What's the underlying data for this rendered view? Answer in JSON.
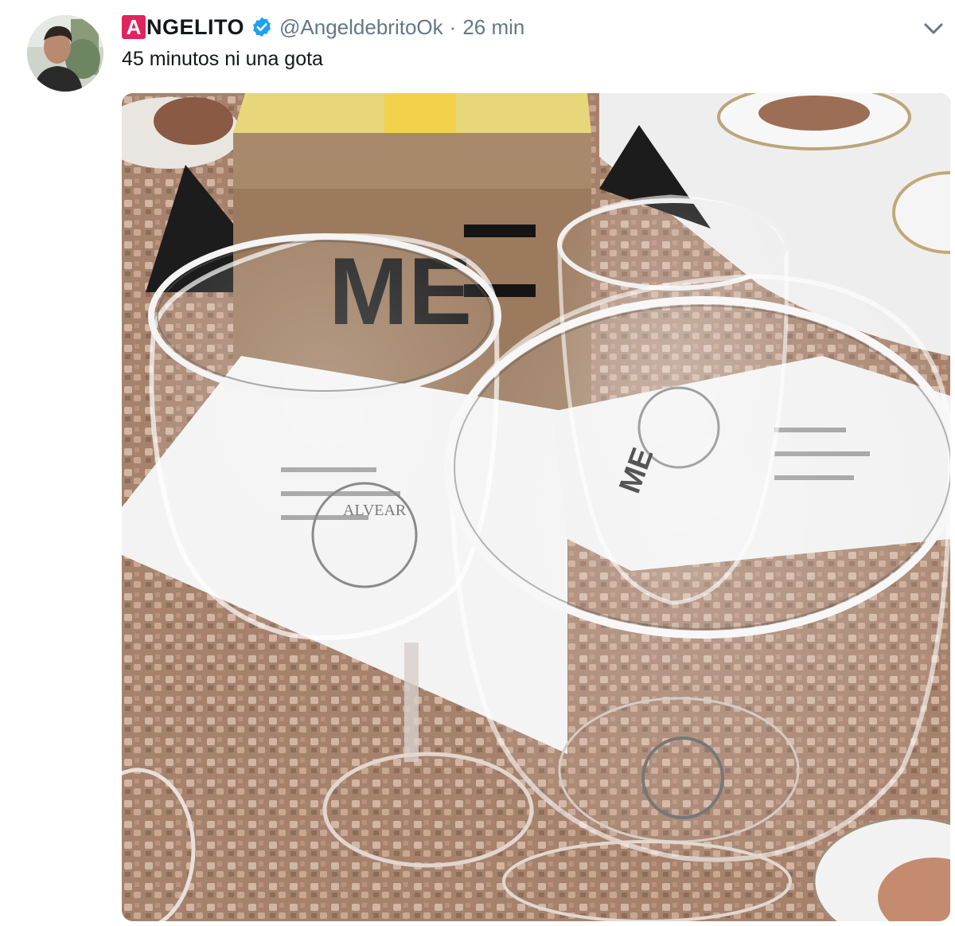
{
  "tweet": {
    "brand_letter": "A",
    "display_name": "NGELITO",
    "handle": "@AngeldebritoOk",
    "separator": "·",
    "time": "26 min",
    "text": "45 minutos ni una gota",
    "verified_icon": "verified-badge-icon",
    "menu_icon": "chevron-down-icon",
    "colors": {
      "brand": "#e0245e",
      "verified": "#1da1f2",
      "text": "#14171a",
      "secondary": "#657786"
    }
  },
  "media": {
    "box_text": "ME",
    "glass_logo_text": "ALVEAR",
    "description_icons": [
      "wine-glass-icon",
      "champagne-flute-icon",
      "menu-card",
      "gift-box"
    ]
  }
}
